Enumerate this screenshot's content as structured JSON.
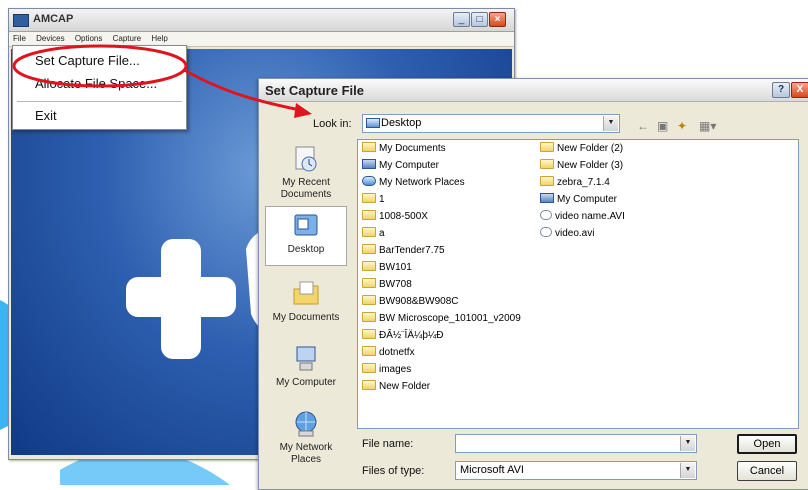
{
  "amcap": {
    "title": "AMCAP",
    "menu": [
      "File",
      "Devices",
      "Options",
      "Capture",
      "Help"
    ],
    "file_menu": {
      "items": [
        "Set Capture File...",
        "Allocate File Space...",
        "Exit"
      ]
    }
  },
  "dialog": {
    "title": "Set Capture File",
    "look_in_label": "Look in:",
    "look_in_value": "Desktop",
    "places": [
      "My Recent Documents",
      "Desktop",
      "My Documents",
      "My Computer",
      "My Network Places"
    ],
    "selected_place": "Desktop",
    "files_col1": [
      {
        "name": "My Documents",
        "icon": "docs"
      },
      {
        "name": "My Computer",
        "icon": "comp"
      },
      {
        "name": "My Network Places",
        "icon": "net"
      },
      {
        "name": "1",
        "icon": "folder"
      },
      {
        "name": "1008-500X",
        "icon": "folder"
      },
      {
        "name": "a",
        "icon": "folder"
      },
      {
        "name": "BarTender7.75",
        "icon": "folder"
      },
      {
        "name": "BW101",
        "icon": "folder"
      },
      {
        "name": "BW708",
        "icon": "folder"
      },
      {
        "name": "BW908&BW908C",
        "icon": "folder"
      },
      {
        "name": "BW Microscope_101001_v2009",
        "icon": "folder"
      },
      {
        "name": "ÐÂ½¨ÎÄ¼þ¼Ð",
        "icon": "folder"
      },
      {
        "name": "dotnetfx",
        "icon": "folder"
      },
      {
        "name": "images",
        "icon": "folder"
      },
      {
        "name": "New Folder",
        "icon": "folder"
      }
    ],
    "files_col2": [
      {
        "name": "New Folder (2)",
        "icon": "folder"
      },
      {
        "name": "New Folder (3)",
        "icon": "folder"
      },
      {
        "name": "zebra_7.1.4",
        "icon": "folder"
      },
      {
        "name": "My Computer",
        "icon": "comp"
      },
      {
        "name": "video name.AVI",
        "icon": "vid"
      },
      {
        "name": "video.avi",
        "icon": "vid"
      }
    ],
    "file_name_label": "File name:",
    "file_name_value": "",
    "files_of_type_label": "Files of type:",
    "files_of_type_value": "Microsoft AVI",
    "open_label": "Open",
    "cancel_label": "Cancel",
    "help_label": "?",
    "close_label": "X"
  },
  "colors": {
    "annotation_red": "#e0141e",
    "watermark_blue": "#1aa7f2"
  },
  "icons": [
    "app-icon",
    "minimize-icon",
    "maximize-icon",
    "close-icon",
    "help-icon",
    "back-arrow-icon",
    "up-folder-icon",
    "new-folder-icon",
    "view-menu-icon",
    "desktop-icon"
  ]
}
